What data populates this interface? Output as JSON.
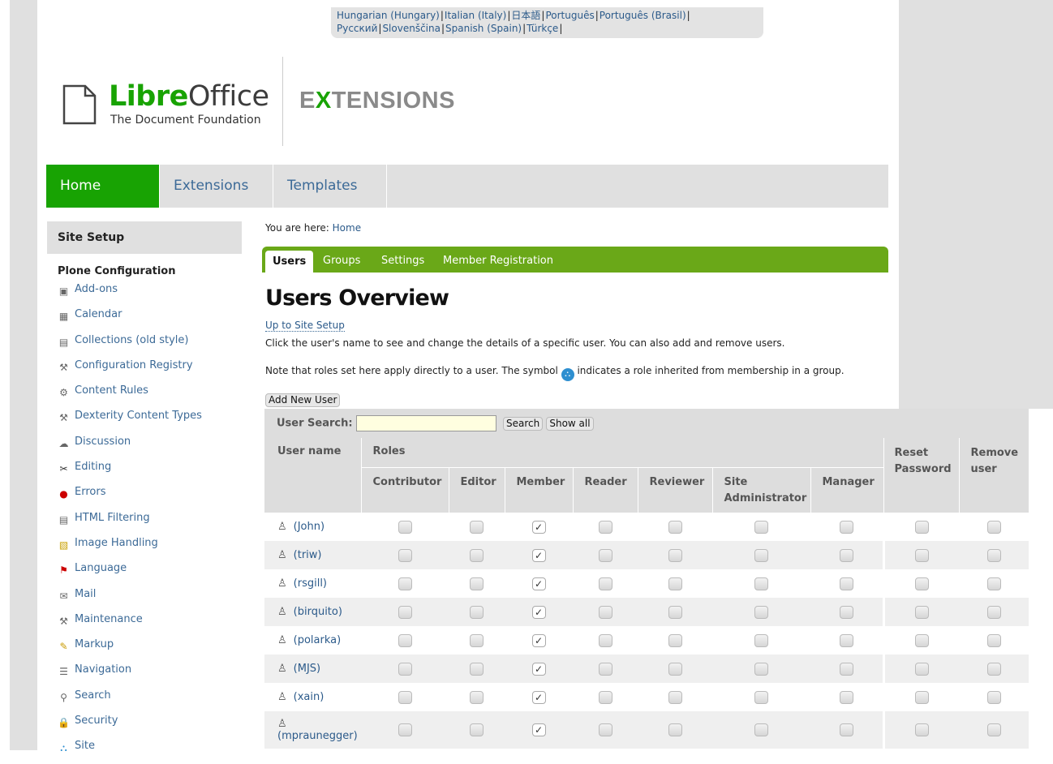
{
  "languages": [
    "Hungarian (Hungary)",
    "Italian (Italy)",
    "日本語",
    "Português",
    "Português (Brasil)",
    "Русский",
    "Slovenščina",
    "Spanish (Spain)",
    "Türkçe"
  ],
  "logo": {
    "libre": "Libre",
    "office": "Office",
    "subtitle": "The Document Foundation",
    "ext_pre": "E",
    "ext_x": "X",
    "ext_post": "TENSIONS"
  },
  "nav": {
    "home": "Home",
    "extensions": "Extensions",
    "templates": "Templates"
  },
  "sidebar": {
    "title": "Site Setup",
    "subtitle": "Plone Configuration",
    "items": [
      {
        "label": "Add-ons",
        "icon": "addons-icon"
      },
      {
        "label": "Calendar",
        "icon": "calendar-icon"
      },
      {
        "label": "Collections (old style)",
        "icon": "collections-icon"
      },
      {
        "label": "Configuration Registry",
        "icon": "wrench-icon"
      },
      {
        "label": "Content Rules",
        "icon": "content-rules-icon"
      },
      {
        "label": "Dexterity Content Types",
        "icon": "wrench-icon"
      },
      {
        "label": "Discussion",
        "icon": "discussion-icon"
      },
      {
        "label": "Editing",
        "icon": "scissors-icon"
      },
      {
        "label": "Errors",
        "icon": "error-icon"
      },
      {
        "label": "HTML Filtering",
        "icon": "html-filter-icon"
      },
      {
        "label": "Image Handling",
        "icon": "image-icon"
      },
      {
        "label": "Language",
        "icon": "flag-icon"
      },
      {
        "label": "Mail",
        "icon": "mail-icon"
      },
      {
        "label": "Maintenance",
        "icon": "wrench-icon"
      },
      {
        "label": "Markup",
        "icon": "pencil-icon"
      },
      {
        "label": "Navigation",
        "icon": "navigation-icon"
      },
      {
        "label": "Search",
        "icon": "search-icon"
      },
      {
        "label": "Security",
        "icon": "lock-icon"
      },
      {
        "label": "Site",
        "icon": "site-icon"
      }
    ]
  },
  "breadcrumb": {
    "prefix": "You are here:",
    "home": "Home"
  },
  "tabs": {
    "users": "Users",
    "groups": "Groups",
    "settings": "Settings",
    "registration": "Member Registration"
  },
  "page": {
    "title": "Users Overview",
    "up_link": "Up to Site Setup",
    "description": "Click the user's name to see and change the details of a specific user. You can also add and remove users.",
    "note_before": "Note that roles set here apply directly to a user. The symbol",
    "note_after": "indicates a role inherited from membership in a group.",
    "add_user": "Add New User"
  },
  "search": {
    "label": "User Search:",
    "value": "",
    "search_button": "Search",
    "show_all_button": "Show all"
  },
  "table": {
    "user_name": "User name",
    "roles": "Roles",
    "reset_password": "Reset Password",
    "remove_user": "Remove user",
    "role_columns": [
      "Contributor",
      "Editor",
      "Member",
      "Reader",
      "Reviewer",
      "Site Administrator",
      "Manager"
    ],
    "users": [
      {
        "name": "(John)",
        "roles": [
          false,
          false,
          true,
          false,
          false,
          false,
          false
        ]
      },
      {
        "name": "(triw)",
        "roles": [
          false,
          false,
          true,
          false,
          false,
          false,
          false
        ]
      },
      {
        "name": "(rsgill)",
        "roles": [
          false,
          false,
          true,
          false,
          false,
          false,
          false
        ]
      },
      {
        "name": "(birquito)",
        "roles": [
          false,
          false,
          true,
          false,
          false,
          false,
          false
        ]
      },
      {
        "name": "(polarka)",
        "roles": [
          false,
          false,
          true,
          false,
          false,
          false,
          false
        ]
      },
      {
        "name": "(MJS)",
        "roles": [
          false,
          false,
          true,
          false,
          false,
          false,
          false
        ]
      },
      {
        "name": "(xain)",
        "roles": [
          false,
          false,
          true,
          false,
          false,
          false,
          false
        ]
      },
      {
        "name": "(mpraunegger)",
        "roles": [
          false,
          false,
          true,
          false,
          false,
          false,
          false
        ]
      }
    ]
  }
}
